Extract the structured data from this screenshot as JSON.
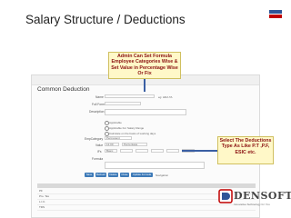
{
  "slide": {
    "title": "Salary Structure / Deductions"
  },
  "form": {
    "section_title": "Common Deduction",
    "name_label": "Name",
    "name_value": "eg: HRA TA",
    "full_form_label": "Full Form",
    "description_label": "Description",
    "applicable_text": "Applicable",
    "salary_range_text": "Applicable For Salary Range",
    "working_days_text": "Calculate on the basis of working days",
    "emp_category_label": "EmpCategory",
    "emp_category_value": "Permanent",
    "value_label": "Value",
    "value_value": "12.00",
    "value_type": "Percentage",
    "ifs_label": "IFs",
    "ifs_value": "Basic",
    "formula_label": "Formula"
  },
  "buttons": [
    "Save",
    "Refresh",
    "Delete",
    "Close",
    "Update Formula"
  ],
  "navigation_label": "Navigation",
  "grid": {
    "rows": [
      "PF",
      "Pro. Tax",
      "L.I.C.",
      "TDS"
    ]
  },
  "callouts": {
    "top": "Admin Can Set Formula Employee Categories Wise & Set Value in Percentage Wise Or Fix",
    "right": "Select The Deductions Type As Like P.T ,P.F, ESIC etc."
  },
  "logo": {
    "brand": "DENSOFT",
    "tagline": "Innovative Technology for You"
  },
  "colors": {
    "flag_blue": "#2f5597",
    "flag_red": "#c00000",
    "button": "#3d7ab8",
    "callout_fill": "#fff8c8",
    "callout_text": "#8a1010",
    "arrow": "#3a5fa3"
  }
}
